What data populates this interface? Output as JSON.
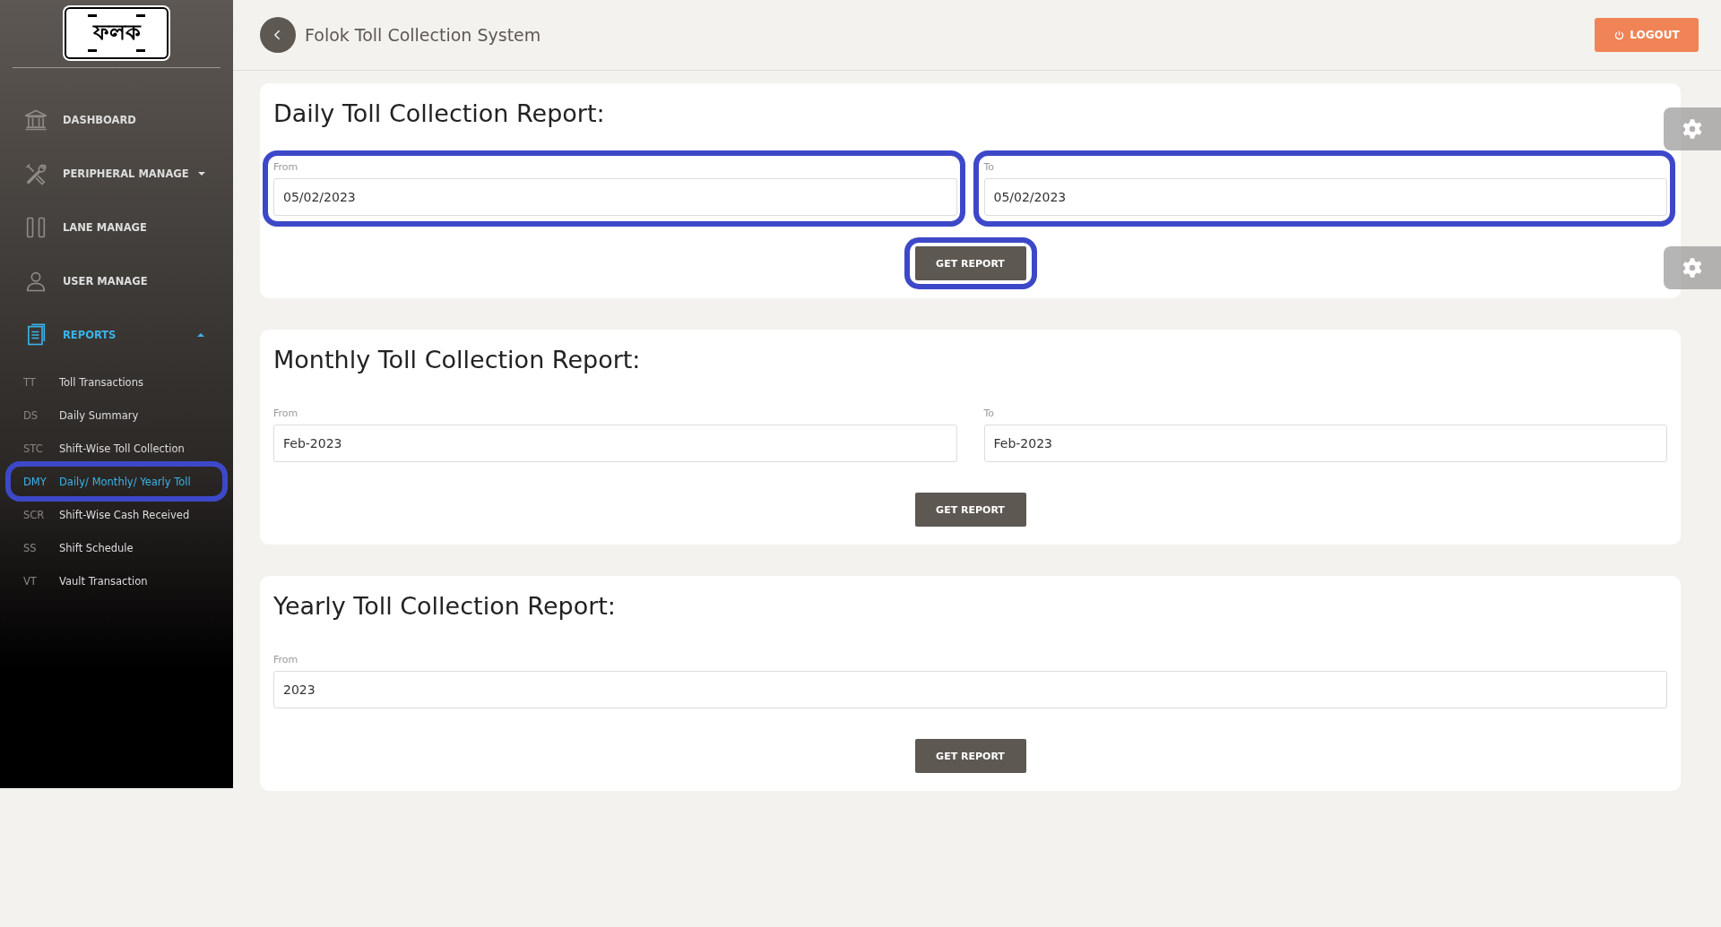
{
  "logo": {
    "text": "ফলক"
  },
  "sidebar": {
    "items": [
      {
        "label": "DASHBOARD",
        "selected": false
      },
      {
        "label": "PERIPHERAL MANAGE",
        "selected": false,
        "expanded": false
      },
      {
        "label": "LANE MANAGE",
        "selected": false
      },
      {
        "label": "USER MANAGE",
        "selected": false
      },
      {
        "label": "REPORTS",
        "selected": true,
        "expanded": true,
        "children": [
          {
            "abbr": "TT",
            "label": "Toll Transactions",
            "selected": false,
            "highlighted": false
          },
          {
            "abbr": "DS",
            "label": "Daily Summary",
            "selected": false,
            "highlighted": false
          },
          {
            "abbr": "STC",
            "label": "Shift-Wise Toll Collection",
            "selected": false,
            "highlighted": false
          },
          {
            "abbr": "DMY",
            "label": "Daily/ Monthly/ Yearly Toll",
            "selected": true,
            "highlighted": true
          },
          {
            "abbr": "SCR",
            "label": "Shift-Wise Cash Received",
            "selected": false,
            "highlighted": false
          },
          {
            "abbr": "SS",
            "label": "Shift Schedule",
            "selected": false,
            "highlighted": false
          },
          {
            "abbr": "VT",
            "label": "Vault Transaction",
            "selected": false,
            "highlighted": false
          }
        ]
      }
    ]
  },
  "header": {
    "title": "Folok Toll Collection System",
    "logout": "LOGOUT"
  },
  "reports": [
    {
      "title": "Daily Toll Collection Report:",
      "fields": [
        {
          "label": "From",
          "value": "05/02/2023",
          "highlighted": true
        },
        {
          "label": "To",
          "value": "05/02/2023",
          "highlighted": true
        }
      ],
      "button": {
        "label": "GET REPORT",
        "highlighted": true
      }
    },
    {
      "title": "Monthly Toll Collection Report:",
      "fields": [
        {
          "label": "From",
          "value": "Feb-2023",
          "highlighted": false
        },
        {
          "label": "To",
          "value": "Feb-2023",
          "highlighted": false
        }
      ],
      "button": {
        "label": "GET REPORT",
        "highlighted": false
      }
    },
    {
      "title": "Yearly Toll Collection Report:",
      "fields": [
        {
          "label": "From",
          "value": "2023",
          "highlighted": false
        }
      ],
      "button": {
        "label": "GET REPORT",
        "highlighted": false
      }
    }
  ]
}
